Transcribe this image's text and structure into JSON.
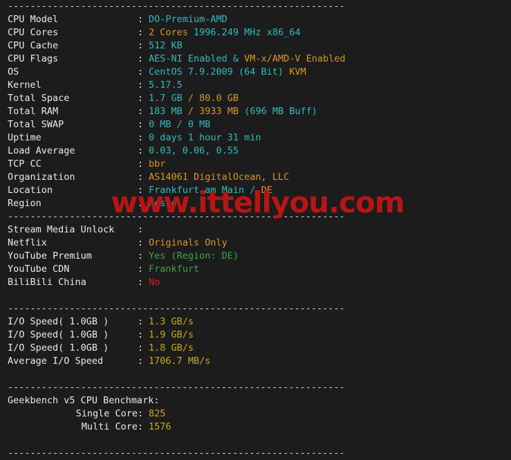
{
  "terminal": {
    "separator": "------------------------------------------------------------",
    "watermark": "www.ittellyou.com",
    "colon": ":",
    "colors": {
      "background": "#1c1c1c",
      "label": "#e8ebee",
      "cyan": "#2fbdbd",
      "orange": "#d79921",
      "green": "#3fa63f",
      "red": "#d01f1f",
      "yellow": "#c9ab19",
      "watermark": "#b71515"
    }
  },
  "system_info": [
    {
      "label": "CPU Model",
      "parts": [
        {
          "text": "DO-Premium-AMD",
          "color": "cyan"
        }
      ]
    },
    {
      "label": "CPU Cores",
      "parts": [
        {
          "text": "2 Cores ",
          "color": "orange"
        },
        {
          "text": "1996.249 MHz x86_64",
          "color": "cyan"
        }
      ]
    },
    {
      "label": "CPU Cache",
      "parts": [
        {
          "text": "512 KB",
          "color": "cyan"
        }
      ]
    },
    {
      "label": "CPU Flags",
      "parts": [
        {
          "text": "AES-NI Enabled & ",
          "color": "cyan"
        },
        {
          "text": "VM-x/AMD-V Enabled",
          "color": "orange"
        }
      ]
    },
    {
      "label": "OS",
      "parts": [
        {
          "text": "CentOS 7.9.2009 (64 Bit) ",
          "color": "cyan"
        },
        {
          "text": "KVM",
          "color": "orange"
        }
      ]
    },
    {
      "label": "Kernel",
      "parts": [
        {
          "text": "5.17.5",
          "color": "cyan"
        }
      ]
    },
    {
      "label": "Total Space",
      "parts": [
        {
          "text": "1.7 GB ",
          "color": "cyan"
        },
        {
          "text": "/ 80.0 GB",
          "color": "orange"
        }
      ]
    },
    {
      "label": "Total RAM",
      "parts": [
        {
          "text": "183 MB ",
          "color": "cyan"
        },
        {
          "text": "/ 3933 MB ",
          "color": "orange"
        },
        {
          "text": "(696 MB Buff)",
          "color": "cyan"
        }
      ]
    },
    {
      "label": "Total SWAP",
      "parts": [
        {
          "text": "0 MB / 0 MB",
          "color": "cyan"
        }
      ]
    },
    {
      "label": "Uptime",
      "parts": [
        {
          "text": "0 days 1 hour 31 min",
          "color": "cyan"
        }
      ]
    },
    {
      "label": "Load Average",
      "parts": [
        {
          "text": "0.03, 0.06, 0.55",
          "color": "cyan"
        }
      ]
    },
    {
      "label": "TCP CC",
      "parts": [
        {
          "text": "bbr",
          "color": "orange"
        }
      ]
    },
    {
      "label": "Organization",
      "parts": [
        {
          "text": "AS14061 DigitalOcean, LLC",
          "color": "orange"
        }
      ]
    },
    {
      "label": "Location",
      "parts": [
        {
          "text": "Frankfurt am Main / ",
          "color": "cyan"
        },
        {
          "text": "DE",
          "color": "orange"
        }
      ]
    },
    {
      "label": "Region",
      "parts": [
        {
          "text": "Hesse",
          "color": "cyan"
        }
      ]
    }
  ],
  "stream_media": {
    "heading": "Stream Media Unlock",
    "rows": [
      {
        "label": "Netflix",
        "parts": [
          {
            "text": "Originals Only",
            "color": "orange"
          }
        ]
      },
      {
        "label": "YouTube Premium",
        "parts": [
          {
            "text": "Yes (Region: DE)",
            "color": "green"
          }
        ]
      },
      {
        "label": "YouTube CDN",
        "parts": [
          {
            "text": "Frankfurt",
            "color": "green"
          }
        ]
      },
      {
        "label": "BiliBili China",
        "parts": [
          {
            "text": "No",
            "color": "red"
          }
        ]
      }
    ]
  },
  "io_speed": [
    {
      "label": "I/O Speed( 1.0GB )",
      "parts": [
        {
          "text": "1.3 GB/s",
          "color": "yellow"
        }
      ]
    },
    {
      "label": "I/O Speed( 1.0GB )",
      "parts": [
        {
          "text": "1.9 GB/s",
          "color": "yellow"
        }
      ]
    },
    {
      "label": "I/O Speed( 1.0GB )",
      "parts": [
        {
          "text": "1.8 GB/s",
          "color": "yellow"
        }
      ]
    },
    {
      "label": "Average I/O Speed",
      "parts": [
        {
          "text": "1706.7 MB/s",
          "color": "yellow"
        }
      ]
    }
  ],
  "geekbench": {
    "heading": "Geekbench v5 CPU Benchmark:",
    "rows": [
      {
        "label": "Single Core",
        "parts": [
          {
            "text": "825",
            "color": "yellow"
          }
        ]
      },
      {
        "label": "Multi Core",
        "parts": [
          {
            "text": "1576",
            "color": "yellow"
          }
        ]
      }
    ]
  }
}
